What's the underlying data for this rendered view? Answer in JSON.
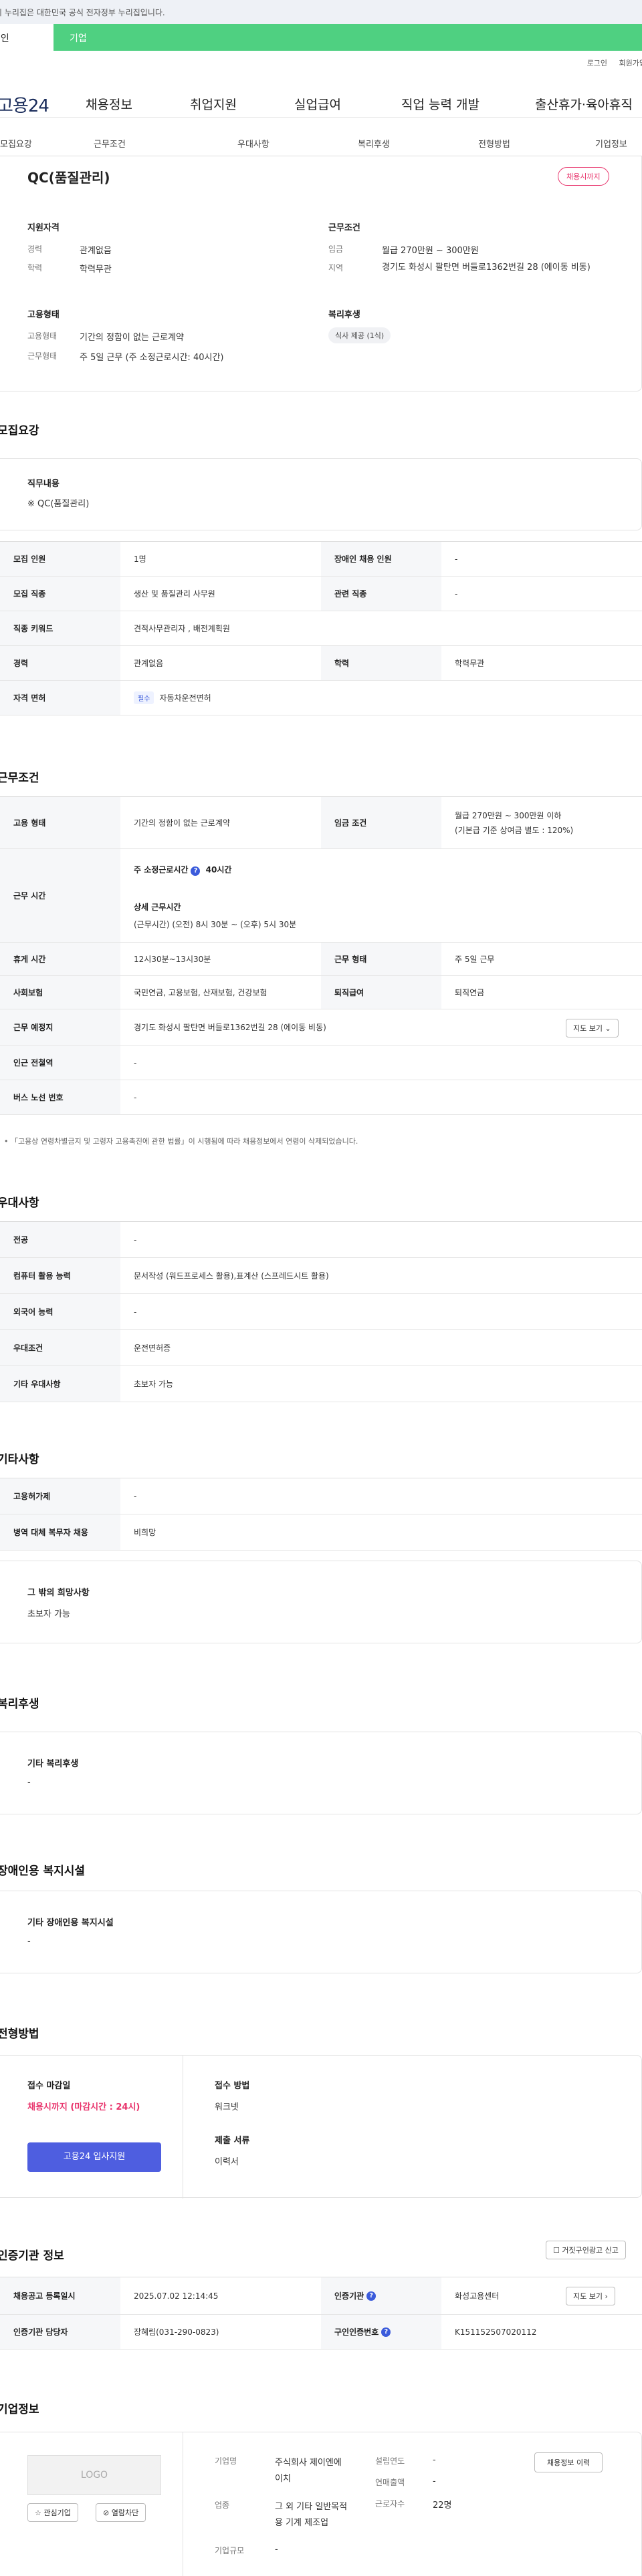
{
  "banner": {
    "text": "이 누리집은 대한민국 공식 전자정부 누리집입니다."
  },
  "typebar": {
    "personal": "개인",
    "company": "기업"
  },
  "util": {
    "login": "로그인",
    "signup": "회원가입"
  },
  "gnb": {
    "logo": "고용24",
    "items": [
      "채용정보",
      "취업지원",
      "실업급여",
      "직업 능력 개발",
      "출산휴가·육아휴직"
    ]
  },
  "subnav": {
    "items": [
      "모집요강",
      "근무조건",
      "우대사항",
      "복리후생",
      "전형방법",
      "기업정보"
    ]
  },
  "summary": {
    "title": "QC(품질관리)",
    "deadline_badge": "채용시까지",
    "qual_title": "지원자격",
    "qual": [
      {
        "k": "경력",
        "v": "관계없음"
      },
      {
        "k": "학력",
        "v": "학력무관"
      }
    ],
    "emp_title": "고용형태",
    "emp": [
      {
        "k": "고용형태",
        "v": "기간의 정함이 없는 근로계약"
      },
      {
        "k": "근무형태",
        "v": "주 5일 근무 (주 소정근로시간: 40시간)"
      }
    ],
    "cond_title": "근무조건",
    "cond": [
      {
        "k": "임금",
        "v": "월급 270만원 ~ 300만원"
      },
      {
        "k": "지역",
        "v": "경기도 화성시 팔탄면 버들로1362번길 28 (에이동 비동)"
      }
    ],
    "welfare_title": "복리후생",
    "welfare_chip": "식사 제공 (1식)"
  },
  "recruit": {
    "heading": "모집요강",
    "duty_title": "직무내용",
    "duty_text": "※ QC(품질관리)",
    "rows": [
      {
        "k1": "모집 인원",
        "v1": "1명",
        "k2": "장애인 채용 인원",
        "v2": "-"
      },
      {
        "k1": "모집 직종",
        "v1": "생산 및 품질관리 사무원",
        "k2": "관련 직종",
        "v2": "-"
      },
      {
        "k1": "직종 키워드",
        "v1": "견적사무관리자 , 배전계획원"
      },
      {
        "k1": "경력",
        "v1": "관계없음",
        "k2": "학력",
        "v2": "학력무관"
      },
      {
        "k1": "자격 면허",
        "tag": "필수",
        "v1": "자동차운전면허"
      }
    ]
  },
  "work": {
    "heading": "근무조건",
    "emp_type_k": "고용 형태",
    "emp_type_v": "기간의 정함이 없는 근로계약",
    "wage_k": "임금 조건",
    "wage_v1": "월급 270만원 ~ 300만원 이하",
    "wage_v2": "(기본급 기준 상여금 별도 : 120%)",
    "hours_k": "근무 시간",
    "hours_title": "주 소정근로시간",
    "hours_value": "40시간",
    "hours_detail_title": "상세 근무시간",
    "hours_detail": "(근무시간) (오전) 8시 30분 ~ (오후) 5시 30분",
    "rest_k": "휴게 시간",
    "rest_v": "12시30분~13시30분",
    "form_k": "근무 형태",
    "form_v": "주 5일 근무",
    "ins_k": "사회보험",
    "ins_v": "국민연금, 고용보험, 산재보험, 건강보험",
    "ret_k": "퇴직급여",
    "ret_v": "퇴직연금",
    "loc_k": "근무 예정지",
    "loc_v": "경기도 화성시 팔탄면 버들로1362번길 28 (에이동 비동)",
    "map_btn": "지도 보기",
    "sub_k": "인근 전철역",
    "sub_v": "-",
    "bus_k": "버스 노선 번호",
    "bus_v": "-",
    "notice": "「고용상 연령차별금지 및 고령자 고용촉진에 관한 법률」이 시행됨에 따라 채용정보에서 연령이 삭제되었습니다."
  },
  "pref": {
    "heading": "우대사항",
    "rows": [
      {
        "k": "전공",
        "v": "-"
      },
      {
        "k": "컴퓨터 활용 능력",
        "v": "문서작성 (워드프로세스 활용),표계산 (스프레드시트 활용)"
      },
      {
        "k": "외국어 능력",
        "v": "-"
      },
      {
        "k": "우대조건",
        "v": "운전면허증"
      },
      {
        "k": "기타 우대사항",
        "v": "초보자 가능"
      }
    ]
  },
  "etc": {
    "heading": "기타사항",
    "rows": [
      {
        "k": "고용허가제",
        "v": "-"
      },
      {
        "k": "병역 대체 복무자 채용",
        "v": "비희망"
      }
    ],
    "wish_title": "그 밖의 희망사항",
    "wish_text": "초보자 가능"
  },
  "welfare": {
    "heading": "복리후생",
    "title": "기타 복리후생",
    "text": "-"
  },
  "disabled": {
    "heading": "장애인용 복지시설",
    "title": "기타 장애인용 복지시설",
    "text": "-"
  },
  "process": {
    "heading": "전형방법",
    "deadline_label": "접수 마감일",
    "deadline_value": "채용시까지 (마감시간 : 24시)",
    "apply_btn": "고용24 입사지원",
    "method_label": "접수 방법",
    "method_value": "워크넷",
    "docs_label": "제출 서류",
    "docs_value": "이력서"
  },
  "auth": {
    "heading": "인증기관 정보",
    "report_btn": "거짓구인광고 신고",
    "r1k1": "채용공고 등록일시",
    "r1v1": "2025.07.02 12:14:45",
    "r1k2": "인증기관",
    "r1v2": "화성고용센터",
    "map_btn": "지도 보기",
    "r2k1": "인증기관 담당자",
    "r2v1": "장혜림(031-290-0823)",
    "r2k2": "구인인증번호",
    "r2v2": "K151152507020112"
  },
  "company": {
    "heading": "기업정보",
    "logo": "LOGO",
    "fav_btn": "관심기업",
    "block_btn": "열람차단",
    "name_k": "기업명",
    "name_v": "주식회사 제이엔에이치",
    "biz_k": "업종",
    "biz_v": "그 외 기타 일반목적용 기계 제조업",
    "size_k": "기업규모",
    "size_v": "-",
    "est_k": "설립연도",
    "est_v": "-",
    "sales_k": "연매출액",
    "sales_v": "-",
    "emp_k": "근로자수",
    "emp_v": "22명",
    "history_btn": "채용정보 이력"
  }
}
